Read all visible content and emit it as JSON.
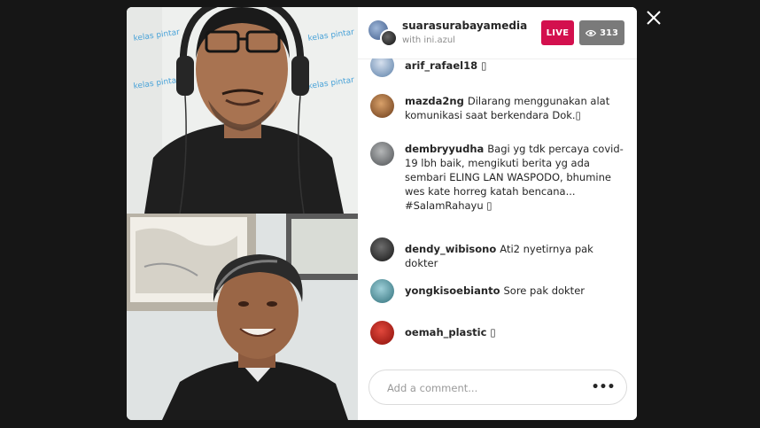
{
  "host": {
    "username": "suarasurabayamedia",
    "subtitle": "with ini.azul"
  },
  "badges": {
    "live": "LIVE",
    "viewers": "313"
  },
  "comments": [
    {
      "username": "arif_rafael18",
      "text": "▯"
    },
    {
      "username": "mazda2ng",
      "text": "Dilarang menggunakan alat komunikasi saat berkendara Dok.▯"
    },
    {
      "username": "dembryyudha",
      "text": "Bagi yg tdk percaya covid-19 lbh baik, mengikuti berita yg ada sembari ELING LAN WASPODO, bhumine wes kate horreg katah bencana... #SalamRahayu ▯"
    },
    {
      "username": "dendy_wibisono",
      "text": "Ati2 nyetirnya pak dokter"
    },
    {
      "username": "yongkisoebianto",
      "text": "Sore pak dokter"
    },
    {
      "username": "oemah_plastic",
      "text": "▯"
    }
  ],
  "composer": {
    "placeholder": "Add a comment...",
    "more_label": "•••"
  },
  "video": {
    "banner_text": "kelas pintar"
  },
  "icons": {
    "close": "close-icon",
    "eye": "eye-icon"
  },
  "colors": {
    "live": "#d3104e",
    "viewer_badge": "#7a7a7a",
    "backdrop": "#161616"
  }
}
